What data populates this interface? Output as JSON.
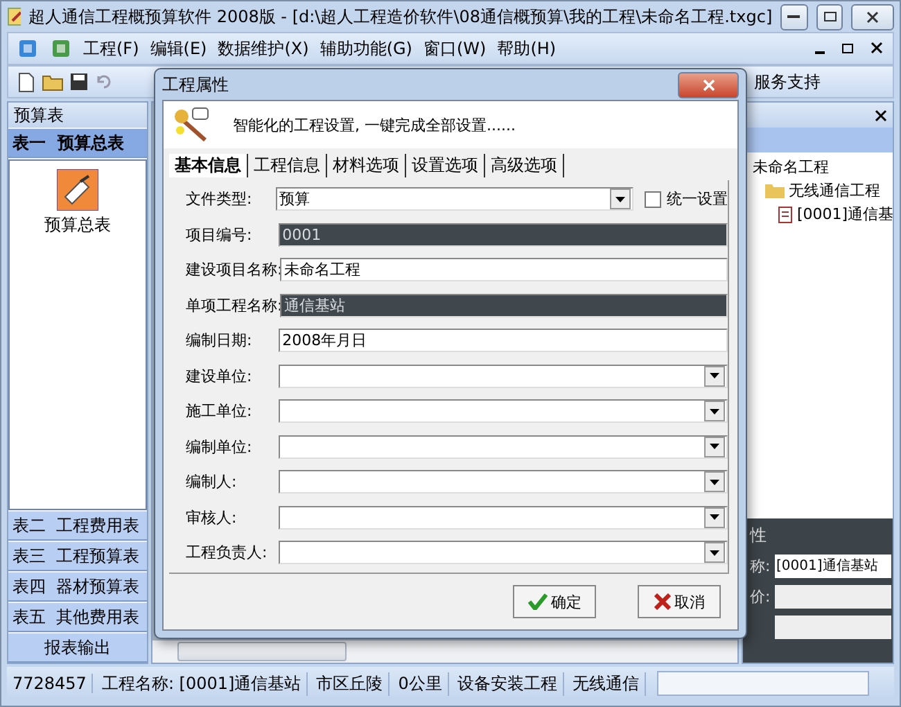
{
  "window": {
    "title": "超人通信工程概预算软件 2008版 - [d:\\超人工程造价软件\\08通信概预算\\我的工程\\未命名工程.txgc]"
  },
  "menu": [
    "工程(F)",
    "编辑(E)",
    "数据维护(X)",
    "辅助功能(G)",
    "窗口(W)",
    "帮助(H)"
  ],
  "toolbar": {
    "label": "服务支持"
  },
  "left_panel": {
    "title": "预算表",
    "sections": [
      {
        "label": "表一  预算总表",
        "expanded": true,
        "items": [
          "预算总表"
        ]
      },
      {
        "label": "表二  工程费用表",
        "expanded": false
      },
      {
        "label": "表三  工程预算表",
        "expanded": false
      },
      {
        "label": "表四  器材预算表",
        "expanded": false
      },
      {
        "label": "表五  其他费用表",
        "expanded": false
      },
      {
        "label": "报表输出",
        "expanded": false
      }
    ]
  },
  "tree": {
    "label": "未命名工程",
    "children": [
      {
        "label": "无线通信工程",
        "children": [
          {
            "label": "[0001]通信基"
          }
        ]
      }
    ]
  },
  "properties": {
    "title": "性",
    "rows": [
      {
        "kind": "field",
        "label": "称:",
        "value": "[0001]通信基站"
      },
      {
        "kind": "field",
        "label": "价:"
      },
      {
        "kind": "field"
      }
    ]
  },
  "status_bar": [
    "7728457",
    "工程名称: [0001]通信基站",
    "市区丘陵",
    "0公里",
    "设备安装工程",
    "无线通信"
  ],
  "dialog": {
    "title": "工程属性",
    "banner": "智能化的工程设置, 一键完成全部设置......",
    "tabs": [
      {
        "label": "基本信息",
        "selected": true
      },
      {
        "label": "工程信息",
        "selected": false
      },
      {
        "label": "材料选项",
        "selected": false
      },
      {
        "label": "设置选项",
        "selected": false
      },
      {
        "label": "高级选项",
        "selected": false
      }
    ],
    "unify": {
      "label": "统一设置",
      "checked": false
    },
    "fields": [
      {
        "label": "文件类型:",
        "kind": "select",
        "value": "预算",
        "readonly": false
      },
      {
        "label": "项目编号:",
        "kind": "text",
        "value": "0001",
        "readonly": true
      },
      {
        "label": "建设项目名称:",
        "kind": "text",
        "value": "未命名工程",
        "readonly": false
      },
      {
        "label": "单项工程名称:",
        "kind": "text",
        "value": "通信基站",
        "readonly": true
      },
      {
        "label": "编制日期:",
        "kind": "text",
        "value": "2008年月日",
        "readonly": false
      },
      {
        "label": "建设单位:",
        "kind": "select",
        "readonly": false
      },
      {
        "label": "施工单位:",
        "kind": "select",
        "readonly": false
      },
      {
        "label": "编制单位:",
        "kind": "select",
        "readonly": false
      },
      {
        "label": "编制人:",
        "kind": "select",
        "readonly": false
      },
      {
        "label": "审核人:",
        "kind": "select",
        "readonly": false
      },
      {
        "label": "工程负责人:",
        "kind": "select",
        "readonly": false
      }
    ],
    "buttons": [
      {
        "label": "确定",
        "kind": "ok"
      },
      {
        "label": "取消",
        "kind": "cancel"
      }
    ]
  }
}
